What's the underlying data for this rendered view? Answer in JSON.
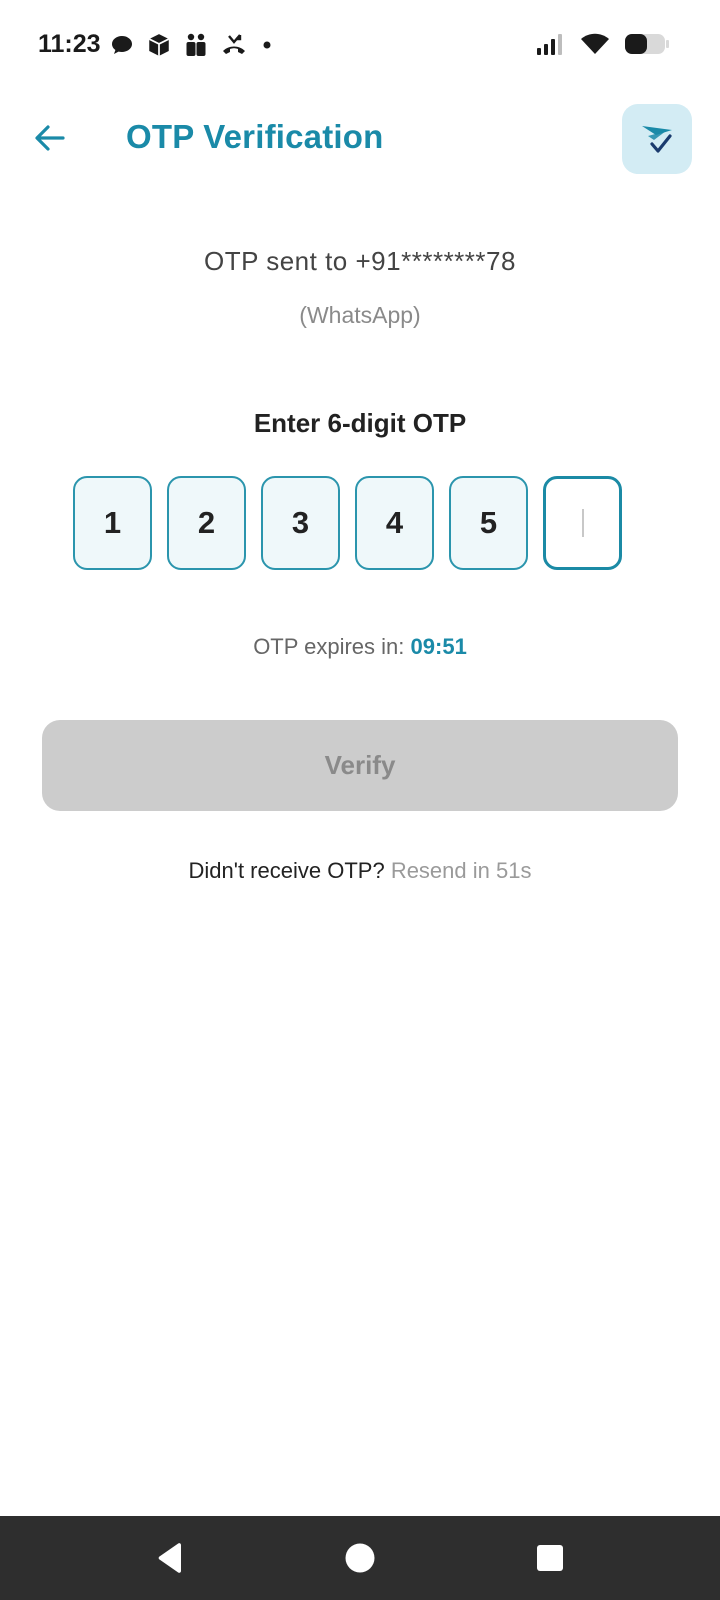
{
  "status_bar": {
    "time": "11:23",
    "icons_left": [
      "chat-bubble-icon",
      "package-icon",
      "people-icon",
      "missed-call-icon",
      "dot-icon"
    ],
    "icons_right": [
      "signal-icon",
      "wifi-icon",
      "battery-icon"
    ]
  },
  "header": {
    "back_icon": "arrow-left-icon",
    "title": "OTP Verification",
    "logo_icon": "paper-plane-check-icon"
  },
  "otp_info": {
    "sent_to": "OTP sent to +91********78",
    "channel": "(WhatsApp)"
  },
  "otp_entry": {
    "heading": "Enter 6-digit OTP",
    "digits": [
      "1",
      "2",
      "3",
      "4",
      "5",
      ""
    ],
    "active_index": 5
  },
  "expiry": {
    "label": "OTP expires in:",
    "time": "09:51"
  },
  "verify_button": {
    "label": "Verify"
  },
  "resend": {
    "question": "Didn't receive OTP?",
    "timer": "Resend in 51s"
  },
  "nav_bar": {
    "buttons": [
      "back-triangle-icon",
      "home-circle-icon",
      "recents-square-icon"
    ]
  },
  "colors": {
    "accent": "#1a8aa8",
    "otp_box_bg": "#eff8fa",
    "button_disabled": "#cccccc",
    "nav_bar": "#2e2e2e"
  }
}
